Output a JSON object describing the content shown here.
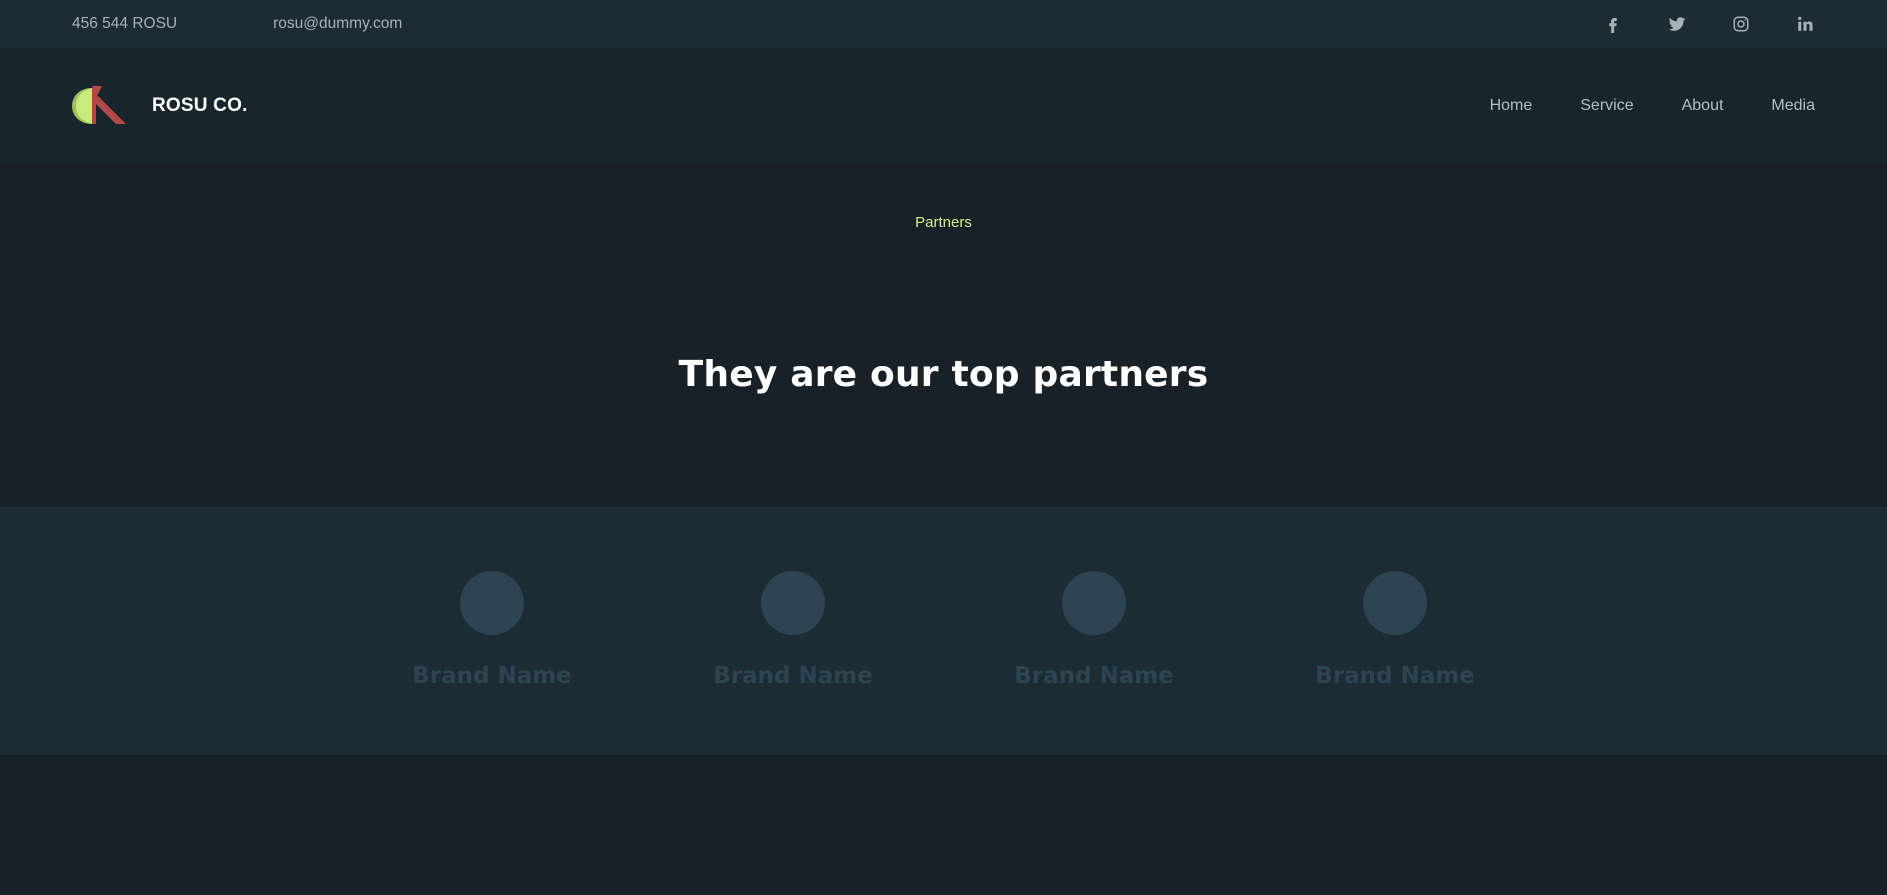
{
  "topbar": {
    "phone": "456 544 ROSU",
    "email": "rosu@dummy.com",
    "socials": [
      {
        "name": "facebook-icon"
      },
      {
        "name": "twitter-icon"
      },
      {
        "name": "instagram-icon"
      },
      {
        "name": "linkedin-icon"
      }
    ]
  },
  "header": {
    "brand_name": "ROSU CO.",
    "nav": [
      {
        "label": "Home"
      },
      {
        "label": "Service"
      },
      {
        "label": "About"
      },
      {
        "label": "Media"
      }
    ]
  },
  "hero": {
    "eyebrow": "Partners",
    "headline": "They are our top partners"
  },
  "partners": [
    {
      "name": "Brand Name"
    },
    {
      "name": "Brand Name"
    },
    {
      "name": "Brand Name"
    },
    {
      "name": "Brand Name"
    }
  ],
  "colors": {
    "topbar_bg": "#1c2b34",
    "header_bg": "#18252d",
    "page_bg": "#172127",
    "accent": "#d4ef8a",
    "logo_green": "#c7ec7c",
    "logo_red": "#b04a4a",
    "partner_placeholder": "#2d4452"
  }
}
